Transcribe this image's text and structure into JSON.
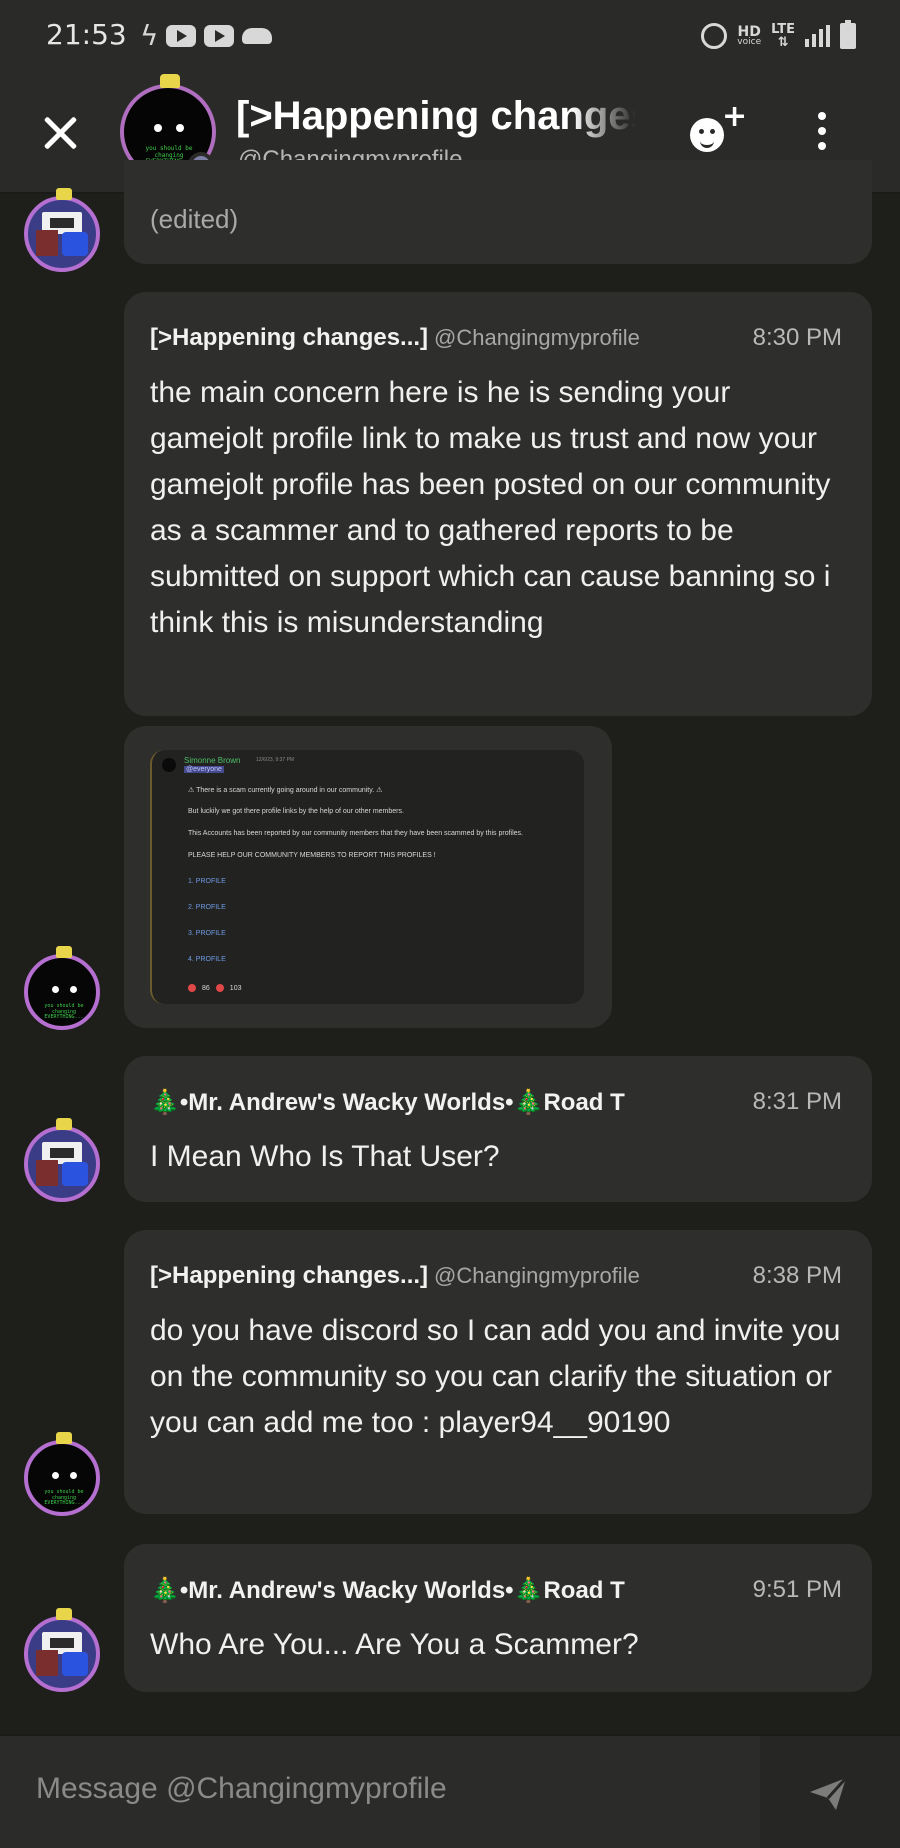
{
  "status_bar": {
    "time": "21:53",
    "hd_label": "HD",
    "voice_label": "voice",
    "lte_label": "LTE"
  },
  "header": {
    "title": "[>Happening changes...]",
    "subtitle": "@Changingmyprofile"
  },
  "avatar_text": "you should be changing EVERYTHING...",
  "messages": [
    {
      "edited": "(edited)"
    },
    {
      "author": "[>Happening changes...]",
      "handle": "@Changingmyprofile",
      "time": "8:30 PM",
      "body": "the main concern here is he is sending your gamejolt profile link to make us trust and now your gamejolt profile has been posted on our community as a scammer and to gathered reports to be submitted on support which can cause banning so i think this is misunderstanding"
    },
    {
      "author": "🎄•Mr. Andrew's Wacky Worlds•🎄Road T",
      "time": "8:31 PM",
      "body": "I Mean Who Is That User?"
    },
    {
      "author": "[>Happening changes...]",
      "handle": "@Changingmyprofile",
      "time": "8:38 PM",
      "body": "do you have discord so I can add you and invite you on the community so you can clarify the situation or you can add me too : player94__90190"
    },
    {
      "author": "🎄•Mr. Andrew's Wacky Worlds•🎄Road T",
      "time": "9:51 PM",
      "body": "Who Are You... Are You a Scammer?"
    }
  ],
  "embed": {
    "name": "Simonne Brown",
    "date": "12/6/23, 9:37 PM",
    "mention": "@everyone",
    "lines": [
      "⚠ There is a scam currently going around in our community. ⚠",
      "But luckily we got there  profile links by the help of our other members.",
      "This Accounts has been reported by our  community members that they have been scammed by this profiles.",
      "PLEASE HELP OUR COMMUNITY MEMBERS TO REPORT THIS PROFILES !"
    ],
    "links": [
      "1. PROFILE",
      "2. PROFILE",
      "3. PROFILE",
      "4. PROFILE"
    ],
    "reactions": [
      "86",
      "103"
    ]
  },
  "composer": {
    "placeholder": "Message @Changingmyprofile"
  }
}
